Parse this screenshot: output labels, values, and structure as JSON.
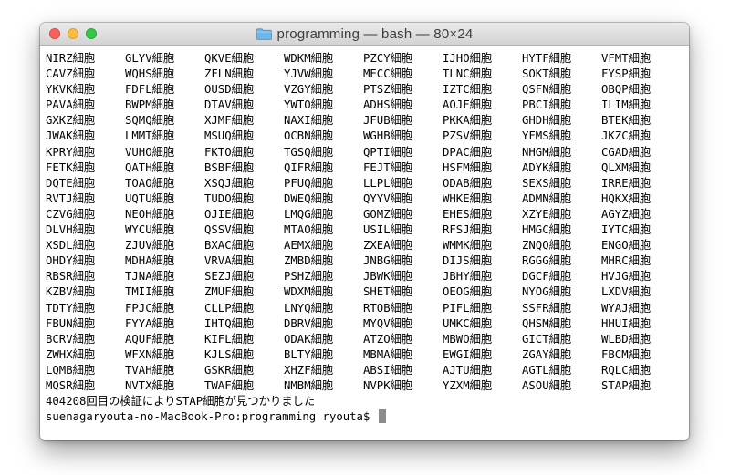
{
  "window": {
    "title": "programming — bash — 80×24"
  },
  "terminal": {
    "cells": [
      "NIRZ細胞",
      "GLYV細胞",
      "QKVE細胞",
      "WDKM細胞",
      "PZCY細胞",
      "IJHO細胞",
      "HYTF細胞",
      "VFMT細胞",
      "CAVZ細胞",
      "WQHS細胞",
      "ZFLN細胞",
      "YJVW細胞",
      "MECC細胞",
      "TLNC細胞",
      "SOKT細胞",
      "FYSP細胞",
      "YKVK細胞",
      "FDFL細胞",
      "OUSD細胞",
      "VZGY細胞",
      "PTSZ細胞",
      "IZTC細胞",
      "QSFN細胞",
      "OBQP細胞",
      "PAVA細胞",
      "BWPM細胞",
      "DTAV細胞",
      "YWTO細胞",
      "ADHS細胞",
      "AOJF細胞",
      "PBCI細胞",
      "ILIM細胞",
      "GXKZ細胞",
      "SQMQ細胞",
      "XJMF細胞",
      "NAXI細胞",
      "JFUB細胞",
      "PKKA細胞",
      "GHDH細胞",
      "BTEK細胞",
      "JWAK細胞",
      "LMMT細胞",
      "MSUQ細胞",
      "OCBN細胞",
      "WGHB細胞",
      "PZSV細胞",
      "YFMS細胞",
      "JKZC細胞",
      "KPRY細胞",
      "VUHO細胞",
      "FKTO細胞",
      "TGSQ細胞",
      "QPTI細胞",
      "DPAC細胞",
      "NHGM細胞",
      "CGAD細胞",
      "FETK細胞",
      "QATH細胞",
      "BSBF細胞",
      "QIFR細胞",
      "FEJT細胞",
      "HSFM細胞",
      "ADYK細胞",
      "QLXM細胞",
      "DQTE細胞",
      "TOAO細胞",
      "XSQJ細胞",
      "PFUQ細胞",
      "LLPL細胞",
      "ODAB細胞",
      "SEXS細胞",
      "IRRE細胞",
      "RVTJ細胞",
      "UQTU細胞",
      "TUDO細胞",
      "DWEQ細胞",
      "QYYV細胞",
      "WHKE細胞",
      "ADMN細胞",
      "HQKX細胞",
      "CZVG細胞",
      "NEOH細胞",
      "OJIE細胞",
      "LMQG細胞",
      "GOMZ細胞",
      "EHES細胞",
      "XZYE細胞",
      "AGYZ細胞",
      "DLVH細胞",
      "WYCU細胞",
      "QSSV細胞",
      "MTAO細胞",
      "USIL細胞",
      "RFSJ細胞",
      "HMGC細胞",
      "IYTC細胞",
      "XSDL細胞",
      "ZJUV細胞",
      "BXAC細胞",
      "AEMX細胞",
      "ZXEA細胞",
      "WMMK細胞",
      "ZNQQ細胞",
      "ENGO細胞",
      "OHDY細胞",
      "MDHA細胞",
      "VRVA細胞",
      "ZMBD細胞",
      "JNBG細胞",
      "DIJS細胞",
      "RGGG細胞",
      "MHRC細胞",
      "RBSR細胞",
      "TJNA細胞",
      "SEZJ細胞",
      "PSHZ細胞",
      "JBWK細胞",
      "JBHY細胞",
      "DGCF細胞",
      "HVJG細胞",
      "KZBV細胞",
      "TMII細胞",
      "ZMUF細胞",
      "WDXM細胞",
      "SHET細胞",
      "OEOG細胞",
      "NYOG細胞",
      "LXDV細胞",
      "TDTY細胞",
      "FPJC細胞",
      "CLLP細胞",
      "LNYQ細胞",
      "RTOB細胞",
      "PIFL細胞",
      "SSFR細胞",
      "WYAJ細胞",
      "FBUN細胞",
      "FYYA細胞",
      "IHTQ細胞",
      "DBRV細胞",
      "MYQV細胞",
      "UMKC細胞",
      "QHSM細胞",
      "HHUI細胞",
      "BCRV細胞",
      "AQUF細胞",
      "KIFL細胞",
      "ODAK細胞",
      "ATZO細胞",
      "MBWO細胞",
      "GICT細胞",
      "WLBD細胞",
      "ZWHX細胞",
      "WFXN細胞",
      "KJLS細胞",
      "BLTY細胞",
      "MBMA細胞",
      "EWGI細胞",
      "ZGAY細胞",
      "FBCM細胞",
      "LQMB細胞",
      "TVAH細胞",
      "GSKR細胞",
      "XHZF細胞",
      "ABSI細胞",
      "AJTU細胞",
      "AGTL細胞",
      "RQLC細胞",
      "MQSR細胞",
      "NVTX細胞",
      "TWAF細胞",
      "NMBM細胞",
      "NVPK細胞",
      "YZXM細胞",
      "ASOU細胞",
      "STAP細胞"
    ],
    "result_line": "404208回目の検証によりSTAP細胞が見つかりました",
    "prompt_line": "suenagaryouta-no-MacBook-Pro:programming ryouta$ "
  }
}
